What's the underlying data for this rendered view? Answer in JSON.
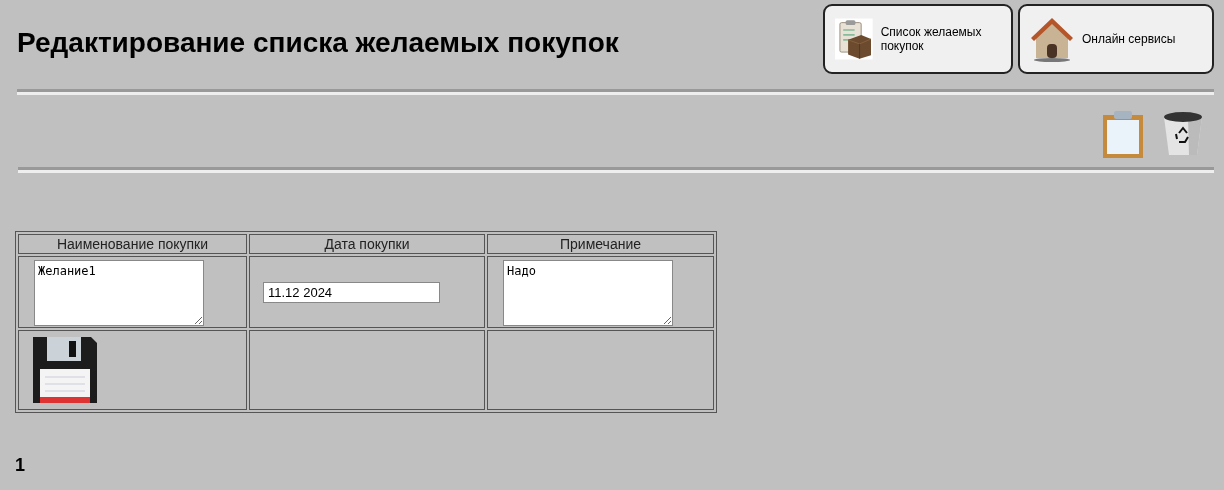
{
  "title": "Редактирование списка желаемых покупок",
  "nav_buttons": [
    {
      "label": "Список желаемых покупок",
      "kind": "wishlist"
    },
    {
      "label": "Онлайн сервисы",
      "kind": "home"
    }
  ],
  "table": {
    "columns": [
      "Наименование покупки",
      "Дата покупки",
      "Примечание"
    ],
    "rows": [
      {
        "name": "Желание1",
        "date": "11.12 2024",
        "note": "Надо"
      }
    ]
  },
  "pager": [
    {
      "label": "1",
      "selected": true
    }
  ]
}
